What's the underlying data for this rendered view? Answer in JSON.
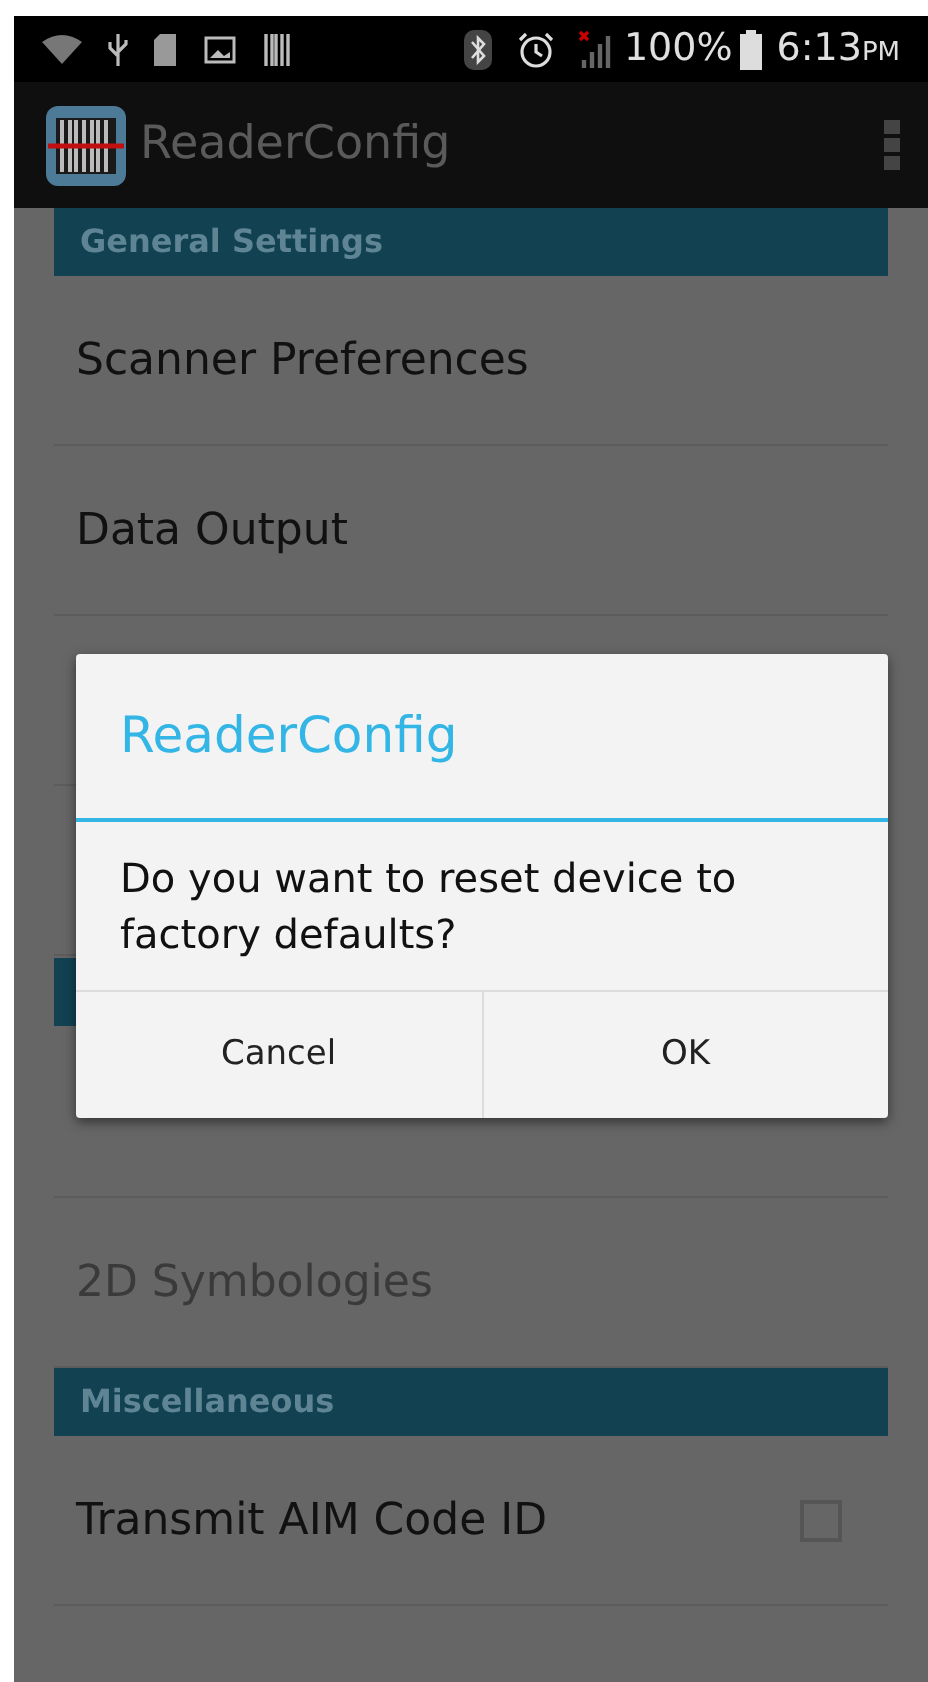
{
  "status_bar": {
    "battery": "100%",
    "time": "6:13",
    "ampm": "PM"
  },
  "action_bar": {
    "title": "ReaderConfig"
  },
  "list": [
    {
      "kind": "header",
      "label": "General Settings"
    },
    {
      "kind": "item",
      "label": "Scanner Preferences",
      "disabled": false
    },
    {
      "kind": "item",
      "label": "Data Output",
      "disabled": false
    },
    {
      "kind": "hidden"
    },
    {
      "kind": "hidden"
    },
    {
      "kind": "header_hidden"
    },
    {
      "kind": "hidden"
    },
    {
      "kind": "item",
      "label": "2D Symbologies",
      "disabled": true
    },
    {
      "kind": "header",
      "label": "Miscellaneous"
    },
    {
      "kind": "checkbox",
      "label": "Transmit AIM Code ID",
      "checked": false
    }
  ],
  "dialog": {
    "title": "ReaderConfig",
    "message": "Do you want to reset device to factory defaults?",
    "buttons": [
      "Cancel",
      "OK"
    ]
  }
}
